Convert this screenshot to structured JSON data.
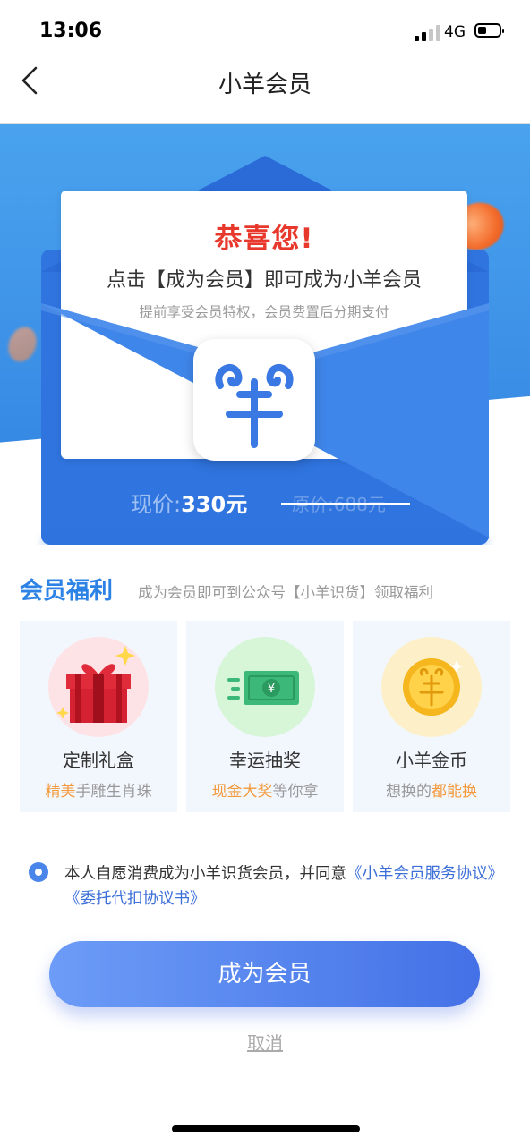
{
  "status_bar": {
    "time": "13:06",
    "network": "4G"
  },
  "nav": {
    "title": "小羊会员"
  },
  "hero": {
    "congrats": "恭喜您!",
    "line1": "点击【成为会员】即可成为小羊会员",
    "line2": "提前享受会员特权，会员费置后分期支付",
    "price_label": "现价:",
    "price_value": "330元",
    "original_price": "原价:688元"
  },
  "benefits": {
    "title": "会员福利",
    "subtitle": "成为会员即可到公众号【小羊识货】领取福利",
    "items": [
      {
        "name": "定制礼盒",
        "desc_highlight": "精美",
        "desc_rest": "手雕生肖珠",
        "icon": "gift-box-icon"
      },
      {
        "name": "幸运抽奖",
        "desc_highlight": "现金大奖",
        "desc_rest": "等你拿",
        "icon": "cash-icon"
      },
      {
        "name": "小羊金币",
        "desc_prefix": "想换的",
        "desc_highlight": "都能换",
        "icon": "gold-coin-icon"
      }
    ]
  },
  "agreement": {
    "text": "本人自愿消费成为小羊识货会员，并同意",
    "link1": "《小羊会员服务协议》",
    "link2": "《委托代扣协议书》"
  },
  "actions": {
    "join": "成为会员",
    "cancel": "取消"
  },
  "colors": {
    "accent": "#4471e6",
    "hero_blue": "#3b8fe6",
    "congrats_red": "#e8382c",
    "highlight_orange": "#f39a3d"
  }
}
